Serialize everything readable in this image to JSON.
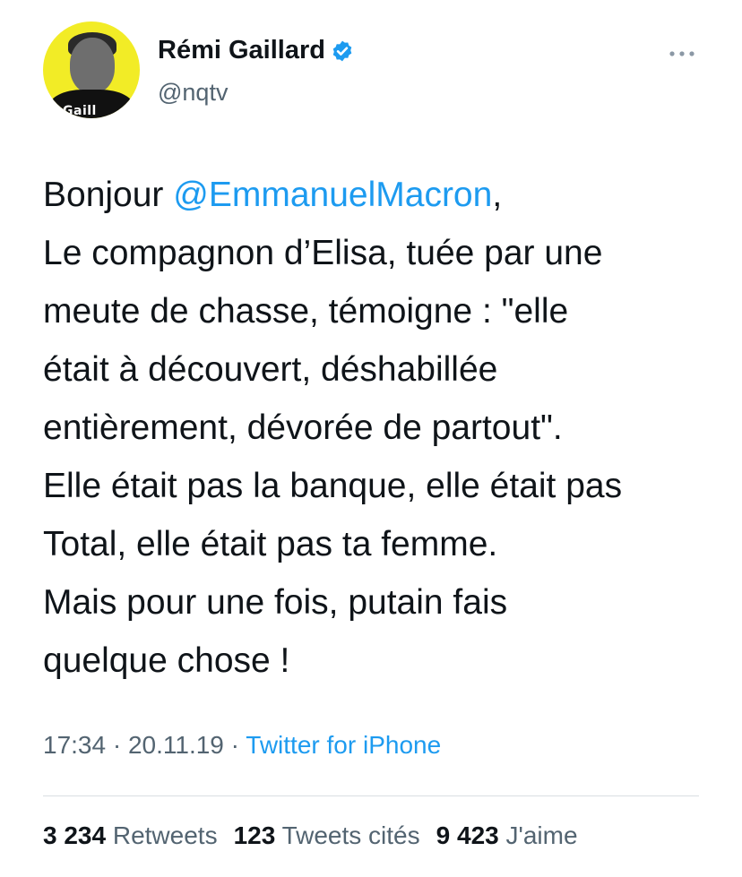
{
  "author": {
    "display_name": "Rémi Gaillard",
    "handle": "@nqtv",
    "avatar_logo_text": "Gaill",
    "verified": true
  },
  "tweet": {
    "greeting": "Bonjour ",
    "mention": "@EmmanuelMacron",
    "mention_suffix": ",",
    "lines": [
      "Le compagnon d’Elisa, tuée par une",
      "meute de chasse, témoigne : \"elle",
      "était à découvert, déshabillée",
      "entièrement, dévorée de partout\".",
      "Elle était pas la banque, elle était pas",
      "Total, elle était pas ta femme.",
      "Mais pour une fois, putain fais",
      "quelque chose !"
    ]
  },
  "meta": {
    "time": "17:34",
    "separator": " · ",
    "date": "20.11.19",
    "source": "Twitter for iPhone"
  },
  "stats": {
    "retweets_count": "3 234",
    "retweets_label": "Retweets",
    "quotes_count": "123",
    "quotes_label": "Tweets cités",
    "likes_count": "9 423",
    "likes_label": "J'aime"
  },
  "colors": {
    "link": "#1d9bf0",
    "secondary_text": "#536471",
    "avatar_background": "#f2ec26"
  },
  "icons": {
    "verified": "verified-badge-icon",
    "more": "more-options-icon"
  }
}
